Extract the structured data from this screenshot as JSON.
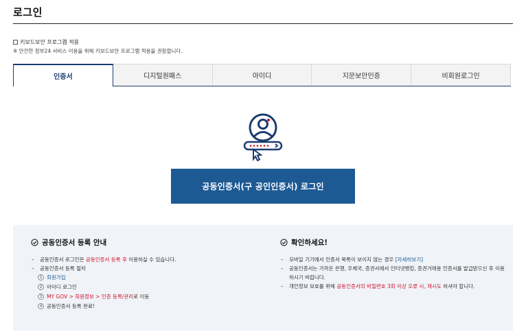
{
  "page": {
    "title": "로그인"
  },
  "keyboard_security": {
    "label": "키보드보안 프로그램 적용",
    "checked": false,
    "note": "※ 안전한 정부24 서비스 이용을 위해 키보드보안 프로그램 적용을 권장합니다."
  },
  "tabs": [
    {
      "label": "인증서",
      "active": true
    },
    {
      "label": "디지털원패스",
      "active": false
    },
    {
      "label": "아이디",
      "active": false
    },
    {
      "label": "지문보안인증",
      "active": false
    },
    {
      "label": "비회원로그인",
      "active": false
    }
  ],
  "login_button": {
    "label": "공동인증서(구 공인인증서) 로그인"
  },
  "guide": {
    "title": "공동인증서 등록 안내",
    "item1_a": "공동인증서 로그인은 ",
    "item1_red": "공동인증서 등록 후",
    "item1_b": " 이용하실 수 있습니다.",
    "item2": "공동인증서 등록 절차",
    "steps": {
      "s1_num": "1",
      "s1": "회원가입",
      "s2_num": "2",
      "s2": "아이디 로그인",
      "s3_num": "3",
      "s3_red": "MY GOV > 회원정보 > 인증 등록/관리",
      "s3_tail": "로 이동",
      "s4_num": "4",
      "s4": "공동인증서 등록 완료!"
    }
  },
  "notice": {
    "title": "확인하세요!",
    "item1_a": "모바일 기기에서 인증서 목록이 보이지 않는 경우 ",
    "item1_link": "[자세히보기]",
    "item2": "공동인증서는 가까운 은행, 우체국, 증권사에서 인터넷뱅킹, 증권거래용 인증서를 발급받으신 후 이용하시기 바랍니다.",
    "item3_a": "개인정보 보호를 위해 ",
    "item3_red": "공동인증서의 비밀번호 3회 이상 오류 시, 재시도",
    "item3_b": " 하셔야 합니다."
  },
  "colors": {
    "primary": "#1d5a94",
    "accent_red": "#d0112b",
    "tab_border": "#1b3b6e",
    "panel_bg": "#f0f4f8"
  },
  "icons": [
    "certificate-user-icon",
    "check-circle-icon"
  ]
}
